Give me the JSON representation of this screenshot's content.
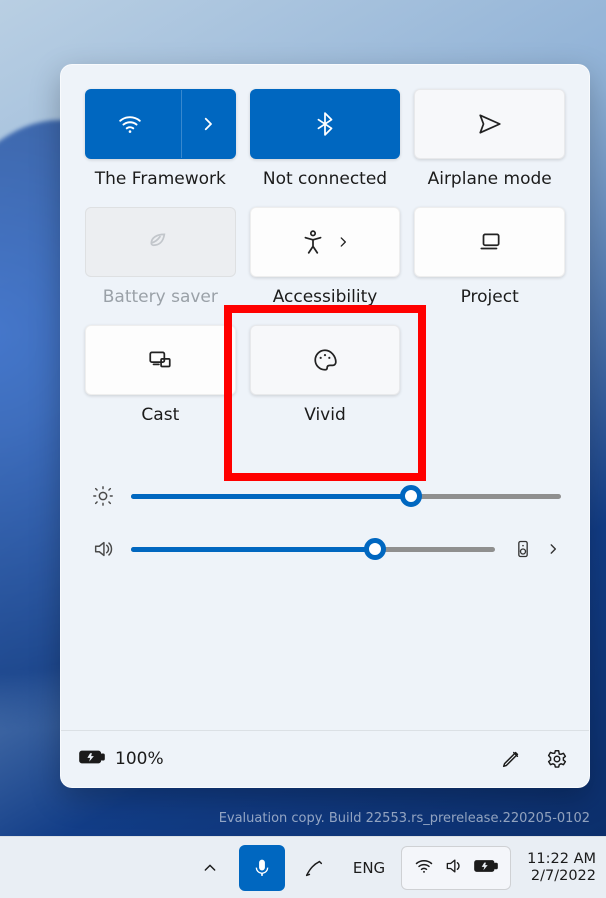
{
  "panel": {
    "tiles": [
      {
        "id": "wifi",
        "label": "The Framework"
      },
      {
        "id": "bluetooth",
        "label": "Not connected"
      },
      {
        "id": "airplane",
        "label": "Airplane mode"
      },
      {
        "id": "battery",
        "label": "Battery saver"
      },
      {
        "id": "accessibility",
        "label": "Accessibility"
      },
      {
        "id": "project",
        "label": "Project"
      },
      {
        "id": "cast",
        "label": "Cast"
      },
      {
        "id": "vivid",
        "label": "Vivid"
      }
    ],
    "brightness": 65,
    "volume": 67,
    "footer": {
      "battery_text": "100%"
    }
  },
  "watermark": {
    "line2": "Evaluation copy. Build 22553.rs_prerelease.220205-0102"
  },
  "taskbar": {
    "language": "ENG",
    "time": "11:22 AM",
    "date": "2/7/2022"
  }
}
